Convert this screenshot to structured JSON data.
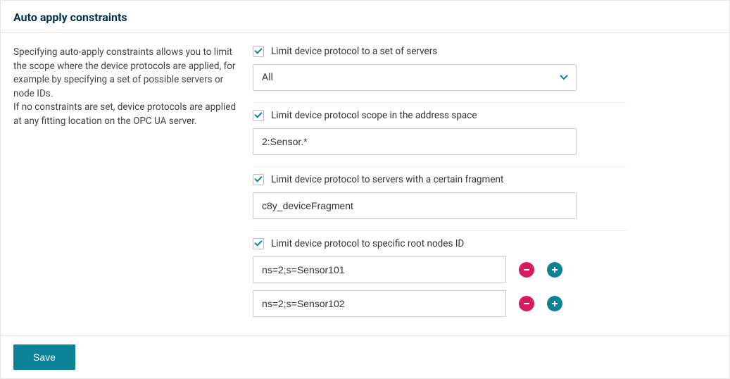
{
  "header": {
    "title": "Auto apply constraints"
  },
  "description": {
    "p1": "Specifying auto-apply constraints allows you to limit the scope where the device protocols are applied, for example by specifying a set of possible servers or node IDs.",
    "p2": "If no constraints are set, device protocols are applied at any fitting location on the OPC UA server."
  },
  "form": {
    "limitServers": {
      "label": "Limit device protocol to a set of servers",
      "checked": true,
      "selectValue": "All"
    },
    "limitScope": {
      "label": "Limit device protocol scope in the address space",
      "checked": true,
      "value": "2:Sensor.*"
    },
    "limitFragment": {
      "label": "Limit device protocol to servers with a certain fragment",
      "checked": true,
      "value": "c8y_deviceFragment"
    },
    "limitRootNodes": {
      "label": "Limit device protocol to specific root nodes ID",
      "checked": true,
      "rows": [
        {
          "value": "ns=2;s=Sensor101"
        },
        {
          "value": "ns=2;s=Sensor102"
        }
      ]
    }
  },
  "footer": {
    "saveLabel": "Save"
  },
  "colors": {
    "accent": "#0b8296",
    "danger": "#d81b60",
    "heading": "#00304a"
  }
}
